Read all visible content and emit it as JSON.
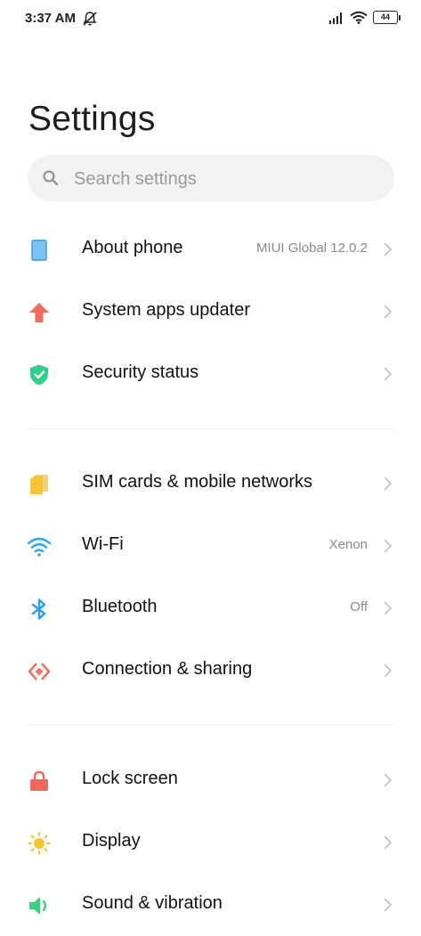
{
  "status_bar": {
    "time": "3:37 AM",
    "battery": "44",
    "icons": [
      "do-not-disturb-icon",
      "signal-icon",
      "wifi-icon",
      "battery-icon"
    ]
  },
  "header": {
    "title": "Settings"
  },
  "search": {
    "placeholder": "Search settings"
  },
  "colors": {
    "about_phone": "#7cc3f5",
    "system_updater": "#f26b5b",
    "security": "#2fd08a",
    "sim": "#f8c53a",
    "wifi": "#34a9f0",
    "bluetooth": "#2a9df4",
    "connection": "#f2705e",
    "lock": "#f0695a",
    "display": "#f7c331",
    "sound": "#39d17c",
    "chevron": "#c4c4c4"
  },
  "groups": [
    {
      "items": [
        {
          "label": "About phone",
          "value": "MIUI Global 12.0.2",
          "icon": "phone-icon"
        },
        {
          "label": "System apps updater",
          "value": "",
          "icon": "arrow-up-icon"
        },
        {
          "label": "Security status",
          "value": "",
          "icon": "shield-check-icon"
        }
      ]
    },
    {
      "items": [
        {
          "label": "SIM cards & mobile networks",
          "value": "",
          "icon": "sim-card-icon"
        },
        {
          "label": "Wi-Fi",
          "value": "Xenon",
          "icon": "wifi-icon"
        },
        {
          "label": "Bluetooth",
          "value": "Off",
          "icon": "bluetooth-icon"
        },
        {
          "label": "Connection & sharing",
          "value": "",
          "icon": "connection-sharing-icon"
        }
      ]
    },
    {
      "items": [
        {
          "label": "Lock screen",
          "value": "",
          "icon": "lock-icon"
        },
        {
          "label": "Display",
          "value": "",
          "icon": "sun-icon"
        },
        {
          "label": "Sound & vibration",
          "value": "",
          "icon": "speaker-icon"
        }
      ]
    }
  ]
}
